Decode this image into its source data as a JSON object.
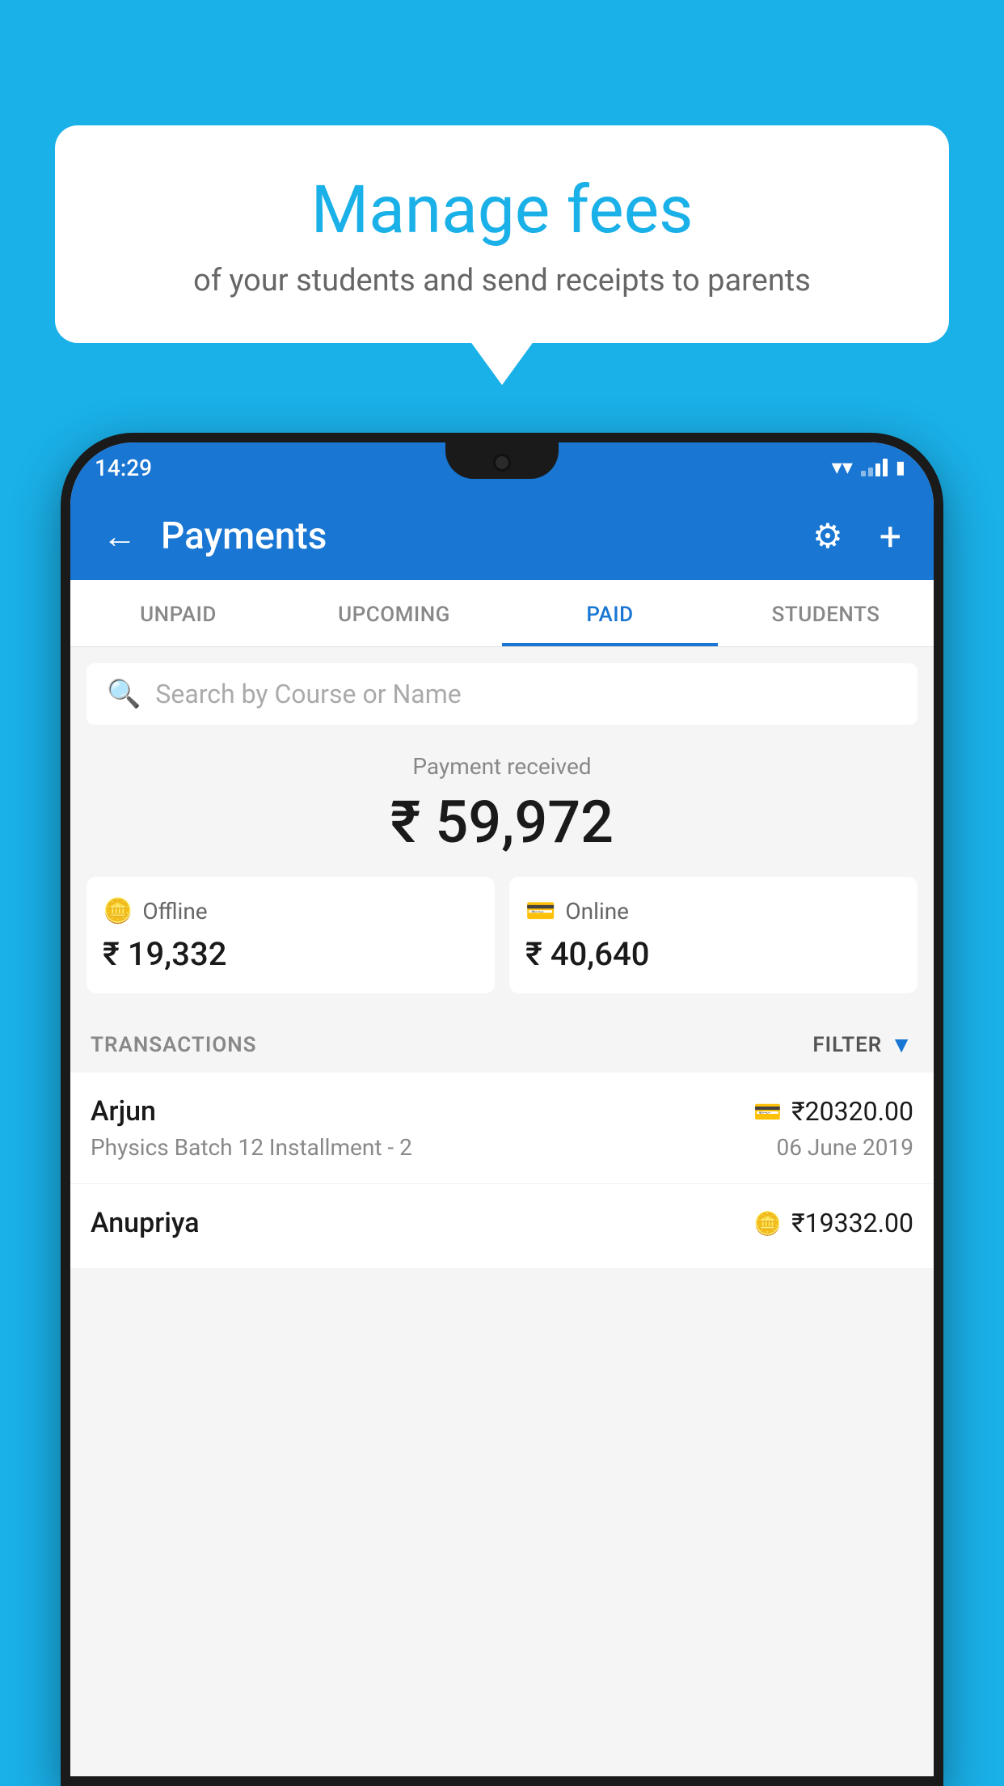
{
  "background_color": "#1ab0e8",
  "bubble": {
    "title": "Manage fees",
    "subtitle": "of your students and send receipts to parents"
  },
  "status_bar": {
    "time": "14:29",
    "icons": [
      "wifi",
      "signal",
      "battery"
    ]
  },
  "app_bar": {
    "title": "Payments",
    "back_label": "←",
    "gear_label": "⚙",
    "plus_label": "+"
  },
  "tabs": [
    {
      "label": "UNPAID",
      "active": false
    },
    {
      "label": "UPCOMING",
      "active": false
    },
    {
      "label": "PAID",
      "active": true
    },
    {
      "label": "STUDENTS",
      "active": false
    }
  ],
  "search": {
    "placeholder": "Search by Course or Name"
  },
  "payment_summary": {
    "label": "Payment received",
    "total": "₹ 59,972",
    "offline_label": "Offline",
    "offline_amount": "₹ 19,332",
    "online_label": "Online",
    "online_amount": "₹ 40,640"
  },
  "transactions_section": {
    "label": "TRANSACTIONS",
    "filter_label": "FILTER"
  },
  "transactions": [
    {
      "name": "Arjun",
      "course": "Physics Batch 12 Installment - 2",
      "amount": "₹20320.00",
      "date": "06 June 2019",
      "payment_type": "card"
    },
    {
      "name": "Anupriya",
      "course": "",
      "amount": "₹19332.00",
      "date": "",
      "payment_type": "offline"
    }
  ]
}
